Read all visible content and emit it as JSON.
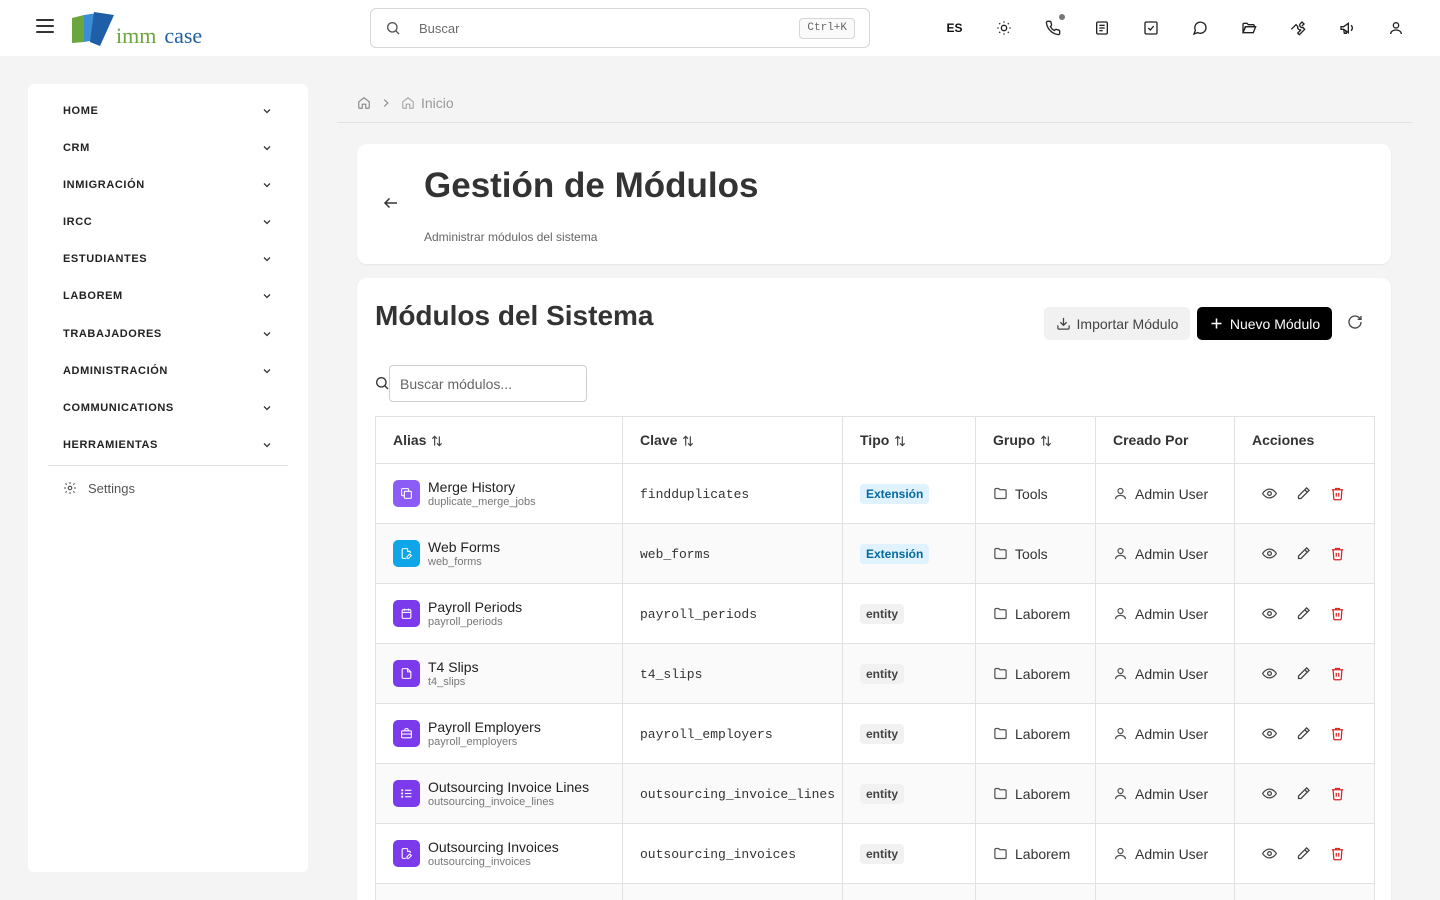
{
  "app": {
    "logo_left": "imm",
    "logo_right": "case",
    "colors": {
      "logo_green": "#6aa63b",
      "logo_blue": "#1f5fa8",
      "primary_button": "#000000",
      "delete": "#dc2626",
      "badge_extension_bg": "#e0f2fe",
      "badge_extension_text": "#0369a1"
    }
  },
  "topbar": {
    "search_placeholder": "Buscar",
    "search_shortcut": "Ctrl+K",
    "language": "ES",
    "icons": [
      "sun-icon",
      "phone-icon",
      "notes-icon",
      "tasks-icon",
      "chat-icon",
      "folder-open-icon",
      "wrench-icon",
      "megaphone-icon",
      "user-icon"
    ]
  },
  "sidebar": {
    "items": [
      {
        "label": "HOME"
      },
      {
        "label": "CRM"
      },
      {
        "label": "INMIGRACIÓN"
      },
      {
        "label": "IRCC"
      },
      {
        "label": "ESTUDIANTES"
      },
      {
        "label": "LABOREM"
      },
      {
        "label": "TRABAJADORES"
      },
      {
        "label": "ADMINISTRACIÓN"
      },
      {
        "label": "COMMUNICATIONS"
      },
      {
        "label": "HERRAMIENTAS"
      }
    ],
    "settings_label": "Settings"
  },
  "breadcrumb": {
    "current": "Inicio"
  },
  "header": {
    "title": "Gestión de Módulos",
    "subtitle": "Administrar módulos del sistema"
  },
  "modules": {
    "title": "Módulos del Sistema",
    "import_label": "Importar Módulo",
    "new_label": "Nuevo Módulo",
    "filter_placeholder": "Buscar módulos...",
    "columns": [
      "Alias",
      "Clave",
      "Tipo",
      "Grupo",
      "Creado Por",
      "Acciones"
    ],
    "rows": [
      {
        "alias": "Merge History",
        "sub": "duplicate_merge_jobs",
        "clave": "findduplicates",
        "tipo": "Extensión",
        "grupo": "Tools",
        "creado": "Admin User",
        "icon": "copy-icon",
        "color": "#8b5cf6"
      },
      {
        "alias": "Web Forms",
        "sub": "web_forms",
        "clave": "web_forms",
        "tipo": "Extensión",
        "grupo": "Tools",
        "creado": "Admin User",
        "icon": "file-edit-icon",
        "color": "#0ea5e9"
      },
      {
        "alias": "Payroll Periods",
        "sub": "payroll_periods",
        "clave": "payroll_periods",
        "tipo": "entity",
        "grupo": "Laborem",
        "creado": "Admin User",
        "icon": "calendar-icon",
        "color": "#7c3aed"
      },
      {
        "alias": "T4 Slips",
        "sub": "t4_slips",
        "clave": "t4_slips",
        "tipo": "entity",
        "grupo": "Laborem",
        "creado": "Admin User",
        "icon": "file-icon",
        "color": "#7c3aed"
      },
      {
        "alias": "Payroll Employers",
        "sub": "payroll_employers",
        "clave": "payroll_employers",
        "tipo": "entity",
        "grupo": "Laborem",
        "creado": "Admin User",
        "icon": "briefcase-icon",
        "color": "#7c3aed"
      },
      {
        "alias": "Outsourcing Invoice Lines",
        "sub": "outsourcing_invoice_lines",
        "clave": "outsourcing_invoice_lines",
        "tipo": "entity",
        "grupo": "Laborem",
        "creado": "Admin User",
        "icon": "list-icon",
        "color": "#7c3aed"
      },
      {
        "alias": "Outsourcing Invoices",
        "sub": "outsourcing_invoices",
        "clave": "outsourcing_invoices",
        "tipo": "entity",
        "grupo": "Laborem",
        "creado": "Admin User",
        "icon": "file-edit-icon",
        "color": "#7c3aed"
      },
      {
        "alias": "",
        "sub": "",
        "clave": "",
        "tipo": "",
        "grupo": "",
        "creado": "",
        "icon": "file-icon",
        "color": "#7c3aed"
      }
    ]
  }
}
